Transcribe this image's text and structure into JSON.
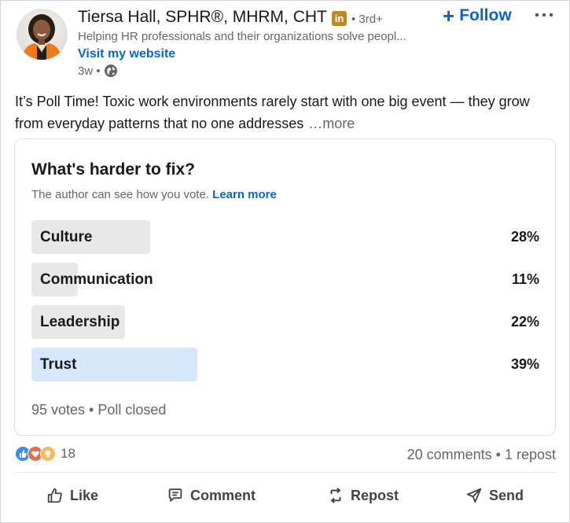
{
  "author": {
    "name": "Tiersa Hall, SPHR®, MHRM, CHT",
    "badge_text": "in",
    "degree": "• 3rd+",
    "headline": "Helping HR professionals and their organizations solve peopl...",
    "website_label": "Visit my website",
    "time": "3w •",
    "visibility_icon": "globe-icon"
  },
  "actions_top": {
    "follow_plus": "+",
    "follow_label": "Follow",
    "more_icon": "ellipsis-icon"
  },
  "post": {
    "text": "It’s Poll Time! Toxic work environments rarely start with one big event — they grow from everyday patterns that no one addresses",
    "see_more": "…more"
  },
  "poll": {
    "question": "What's harder to fix?",
    "note": "The author can see how you vote.",
    "learn_more": "Learn more",
    "options": [
      {
        "label": "Culture",
        "percent_text": "28%",
        "percent": 28,
        "selected": false
      },
      {
        "label": "Communication",
        "percent_text": "11%",
        "percent": 11,
        "selected": false
      },
      {
        "label": "Leadership",
        "percent_text": "22%",
        "percent": 22,
        "selected": false
      },
      {
        "label": "Trust",
        "percent_text": "39%",
        "percent": 39,
        "selected": true
      }
    ],
    "footer": "95 votes • Poll closed"
  },
  "social": {
    "reaction_icons": [
      "like-icon",
      "love-icon",
      "insightful-icon"
    ],
    "reaction_count": "18",
    "comments_reposts": "20 comments • 1 repost"
  },
  "action_bar": {
    "like": "Like",
    "comment": "Comment",
    "repost": "Repost",
    "send": "Send"
  },
  "colors": {
    "brand_blue": "#0a66c2",
    "poll_bar": "#e8e8e8",
    "poll_bar_selected": "#d6e7fb",
    "muted_text": "#666666"
  }
}
